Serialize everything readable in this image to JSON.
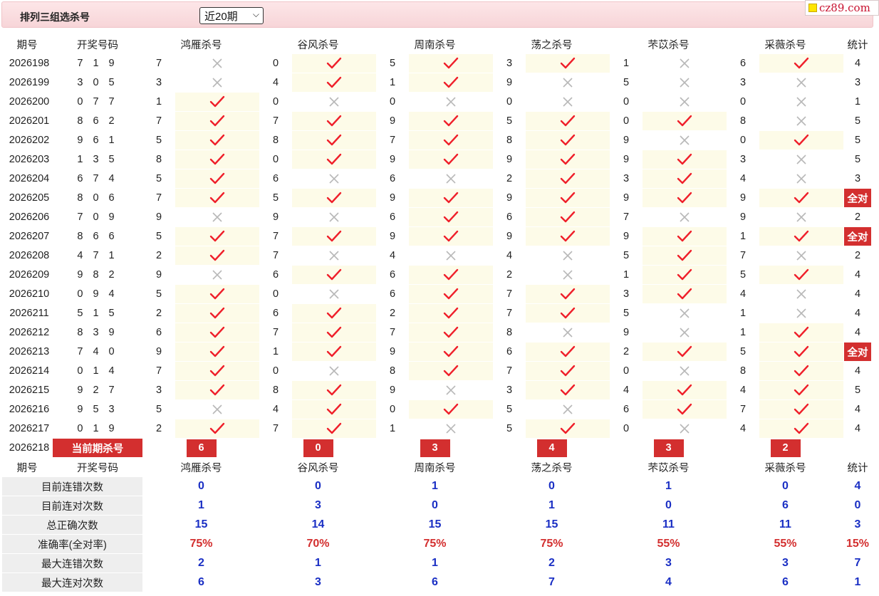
{
  "header": {
    "title": "排列三组选杀号",
    "period_select": "近20期",
    "brand": "cz89.com"
  },
  "columns": {
    "issue": "期号",
    "winning": "开奖号码",
    "experts": [
      "鸿雁杀号",
      "谷风杀号",
      "周南杀号",
      "荡之杀号",
      "芣苡杀号",
      "采薇杀号"
    ],
    "stat": "统计"
  },
  "rows": [
    {
      "issue": "2026198",
      "win": "7 1 9",
      "picks": [
        [
          "7",
          "x"
        ],
        [
          "0",
          "v"
        ],
        [
          "5",
          "v"
        ],
        [
          "3",
          "v"
        ],
        [
          "1",
          "x"
        ],
        [
          "6",
          "v"
        ]
      ],
      "stat": "4"
    },
    {
      "issue": "2026199",
      "win": "3 0 5",
      "picks": [
        [
          "3",
          "x"
        ],
        [
          "4",
          "v"
        ],
        [
          "1",
          "v"
        ],
        [
          "9",
          "x"
        ],
        [
          "5",
          "x"
        ],
        [
          "3",
          "x"
        ]
      ],
      "stat": "3"
    },
    {
      "issue": "2026200",
      "win": "0 7 7",
      "picks": [
        [
          "1",
          "v"
        ],
        [
          "0",
          "x"
        ],
        [
          "0",
          "x"
        ],
        [
          "0",
          "x"
        ],
        [
          "0",
          "x"
        ],
        [
          "0",
          "x"
        ]
      ],
      "stat": "1"
    },
    {
      "issue": "2026201",
      "win": "8 6 2",
      "picks": [
        [
          "7",
          "v"
        ],
        [
          "7",
          "v"
        ],
        [
          "9",
          "v"
        ],
        [
          "5",
          "v"
        ],
        [
          "0",
          "v"
        ],
        [
          "8",
          "x"
        ]
      ],
      "stat": "5"
    },
    {
      "issue": "2026202",
      "win": "9 6 1",
      "picks": [
        [
          "5",
          "v"
        ],
        [
          "8",
          "v"
        ],
        [
          "7",
          "v"
        ],
        [
          "8",
          "v"
        ],
        [
          "9",
          "x"
        ],
        [
          "0",
          "v"
        ]
      ],
      "stat": "5"
    },
    {
      "issue": "2026203",
      "win": "1 3 5",
      "picks": [
        [
          "8",
          "v"
        ],
        [
          "0",
          "v"
        ],
        [
          "9",
          "v"
        ],
        [
          "9",
          "v"
        ],
        [
          "9",
          "v"
        ],
        [
          "3",
          "x"
        ]
      ],
      "stat": "5"
    },
    {
      "issue": "2026204",
      "win": "6 7 4",
      "picks": [
        [
          "5",
          "v"
        ],
        [
          "6",
          "x"
        ],
        [
          "6",
          "x"
        ],
        [
          "2",
          "v"
        ],
        [
          "3",
          "v"
        ],
        [
          "4",
          "x"
        ]
      ],
      "stat": "3"
    },
    {
      "issue": "2026205",
      "win": "8 0 6",
      "picks": [
        [
          "7",
          "v"
        ],
        [
          "5",
          "v"
        ],
        [
          "9",
          "v"
        ],
        [
          "9",
          "v"
        ],
        [
          "9",
          "v"
        ],
        [
          "9",
          "v"
        ]
      ],
      "stat": "全对"
    },
    {
      "issue": "2026206",
      "win": "7 0 9",
      "picks": [
        [
          "9",
          "x"
        ],
        [
          "9",
          "x"
        ],
        [
          "6",
          "v"
        ],
        [
          "6",
          "v"
        ],
        [
          "7",
          "x"
        ],
        [
          "9",
          "x"
        ]
      ],
      "stat": "2"
    },
    {
      "issue": "2026207",
      "win": "8 6 6",
      "picks": [
        [
          "5",
          "v"
        ],
        [
          "7",
          "v"
        ],
        [
          "9",
          "v"
        ],
        [
          "9",
          "v"
        ],
        [
          "9",
          "v"
        ],
        [
          "1",
          "v"
        ]
      ],
      "stat": "全对"
    },
    {
      "issue": "2026208",
      "win": "4 7 1",
      "picks": [
        [
          "2",
          "v"
        ],
        [
          "7",
          "x"
        ],
        [
          "4",
          "x"
        ],
        [
          "4",
          "x"
        ],
        [
          "5",
          "v"
        ],
        [
          "7",
          "x"
        ]
      ],
      "stat": "2"
    },
    {
      "issue": "2026209",
      "win": "9 8 2",
      "picks": [
        [
          "9",
          "x"
        ],
        [
          "6",
          "v"
        ],
        [
          "6",
          "v"
        ],
        [
          "2",
          "x"
        ],
        [
          "1",
          "v"
        ],
        [
          "5",
          "v"
        ]
      ],
      "stat": "4"
    },
    {
      "issue": "2026210",
      "win": "0 9 4",
      "picks": [
        [
          "5",
          "v"
        ],
        [
          "0",
          "x"
        ],
        [
          "6",
          "v"
        ],
        [
          "7",
          "v"
        ],
        [
          "3",
          "v"
        ],
        [
          "4",
          "x"
        ]
      ],
      "stat": "4"
    },
    {
      "issue": "2026211",
      "win": "5 1 5",
      "picks": [
        [
          "2",
          "v"
        ],
        [
          "6",
          "v"
        ],
        [
          "2",
          "v"
        ],
        [
          "7",
          "v"
        ],
        [
          "5",
          "x"
        ],
        [
          "1",
          "x"
        ]
      ],
      "stat": "4"
    },
    {
      "issue": "2026212",
      "win": "8 3 9",
      "picks": [
        [
          "6",
          "v"
        ],
        [
          "7",
          "v"
        ],
        [
          "7",
          "v"
        ],
        [
          "8",
          "x"
        ],
        [
          "9",
          "x"
        ],
        [
          "1",
          "v"
        ]
      ],
      "stat": "4"
    },
    {
      "issue": "2026213",
      "win": "7 4 0",
      "picks": [
        [
          "9",
          "v"
        ],
        [
          "1",
          "v"
        ],
        [
          "9",
          "v"
        ],
        [
          "6",
          "v"
        ],
        [
          "2",
          "v"
        ],
        [
          "5",
          "v"
        ]
      ],
      "stat": "全对"
    },
    {
      "issue": "2026214",
      "win": "0 1 4",
      "picks": [
        [
          "7",
          "v"
        ],
        [
          "0",
          "x"
        ],
        [
          "8",
          "v"
        ],
        [
          "7",
          "v"
        ],
        [
          "0",
          "x"
        ],
        [
          "8",
          "v"
        ]
      ],
      "stat": "4"
    },
    {
      "issue": "2026215",
      "win": "9 2 7",
      "picks": [
        [
          "3",
          "v"
        ],
        [
          "8",
          "v"
        ],
        [
          "9",
          "x"
        ],
        [
          "3",
          "v"
        ],
        [
          "4",
          "v"
        ],
        [
          "4",
          "v"
        ]
      ],
      "stat": "5"
    },
    {
      "issue": "2026216",
      "win": "9 5 3",
      "picks": [
        [
          "5",
          "x"
        ],
        [
          "4",
          "v"
        ],
        [
          "0",
          "v"
        ],
        [
          "5",
          "x"
        ],
        [
          "6",
          "v"
        ],
        [
          "7",
          "v"
        ]
      ],
      "stat": "4"
    },
    {
      "issue": "2026217",
      "win": "0 1 9",
      "picks": [
        [
          "2",
          "v"
        ],
        [
          "7",
          "v"
        ],
        [
          "1",
          "x"
        ],
        [
          "5",
          "v"
        ],
        [
          "0",
          "x"
        ],
        [
          "4",
          "v"
        ]
      ],
      "stat": "4"
    }
  ],
  "current": {
    "issue": "2026218",
    "label": "当前期杀号",
    "kills": [
      "6",
      "0",
      "3",
      "4",
      "3",
      "2"
    ]
  },
  "summary": [
    {
      "label": "目前连错次数",
      "vals": [
        "0",
        "0",
        "1",
        "0",
        "1",
        "0"
      ],
      "stat": "4",
      "color": "blue"
    },
    {
      "label": "目前连对次数",
      "vals": [
        "1",
        "3",
        "0",
        "1",
        "0",
        "6"
      ],
      "stat": "0",
      "color": "blue"
    },
    {
      "label": "总正确次数",
      "vals": [
        "15",
        "14",
        "15",
        "15",
        "11",
        "11"
      ],
      "stat": "3",
      "color": "blue"
    },
    {
      "label": "准确率(全对率)",
      "vals": [
        "75%",
        "70%",
        "75%",
        "75%",
        "55%",
        "55%"
      ],
      "stat": "15%",
      "color": "red"
    },
    {
      "label": "最大连错次数",
      "vals": [
        "2",
        "1",
        "1",
        "2",
        "3",
        "3"
      ],
      "stat": "7",
      "color": "blue"
    },
    {
      "label": "最大连对次数",
      "vals": [
        "6",
        "3",
        "6",
        "7",
        "4",
        "6"
      ],
      "stat": "1",
      "color": "blue"
    }
  ],
  "colors": {
    "accent_red": "#d32f2f",
    "check_red": "#ef1f2a",
    "cross_grey": "#b8b8b8",
    "value_blue": "#1a2fc4",
    "ok_bg": "#fdfbe8"
  }
}
